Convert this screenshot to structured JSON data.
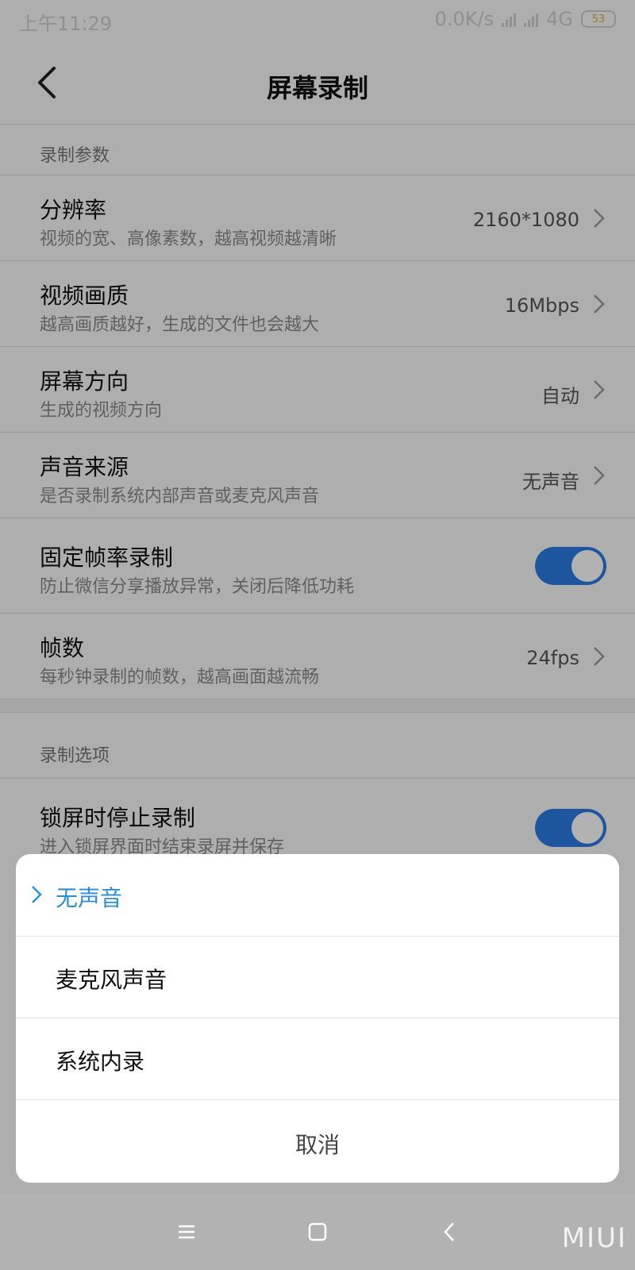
{
  "status_bar": {
    "time": "上午11:29",
    "net_speed": "0.0K/s",
    "network": "4G",
    "battery": "53"
  },
  "header": {
    "title": "屏幕录制"
  },
  "section1": {
    "title": "录制参数"
  },
  "rows": [
    {
      "title": "分辨率",
      "subtitle": "视频的宽、高像素数，越高视频越清晰",
      "value": "2160*1080"
    },
    {
      "title": "视频画质",
      "subtitle": "越高画质越好，生成的文件也会越大",
      "value": "16Mbps"
    },
    {
      "title": "屏幕方向",
      "subtitle": "生成的视频方向",
      "value": "自动"
    },
    {
      "title": "声音来源",
      "subtitle": "是否录制系统内部声音或麦克风声音",
      "value": "无声音"
    },
    {
      "title": "固定帧率录制",
      "subtitle": "防止微信分享播放异常，关闭后降低功耗",
      "toggle": true
    },
    {
      "title": "帧数",
      "subtitle": "每秒钟录制的帧数，越高画面越流畅",
      "value": "24fps"
    }
  ],
  "section2": {
    "title": "录制选项"
  },
  "rows2": [
    {
      "title": "锁屏时停止录制",
      "subtitle": "进入锁屏界面时结束录屏并保存",
      "toggle": true
    }
  ],
  "sheet": {
    "options": [
      {
        "label": "无声音",
        "selected": true
      },
      {
        "label": "麦克风声音",
        "selected": false
      },
      {
        "label": "系统内录",
        "selected": false
      }
    ],
    "cancel": "取消"
  },
  "watermark": "MIUI",
  "colors": {
    "accent": "#2a7be4",
    "selected_text": "#2a8fd6"
  }
}
